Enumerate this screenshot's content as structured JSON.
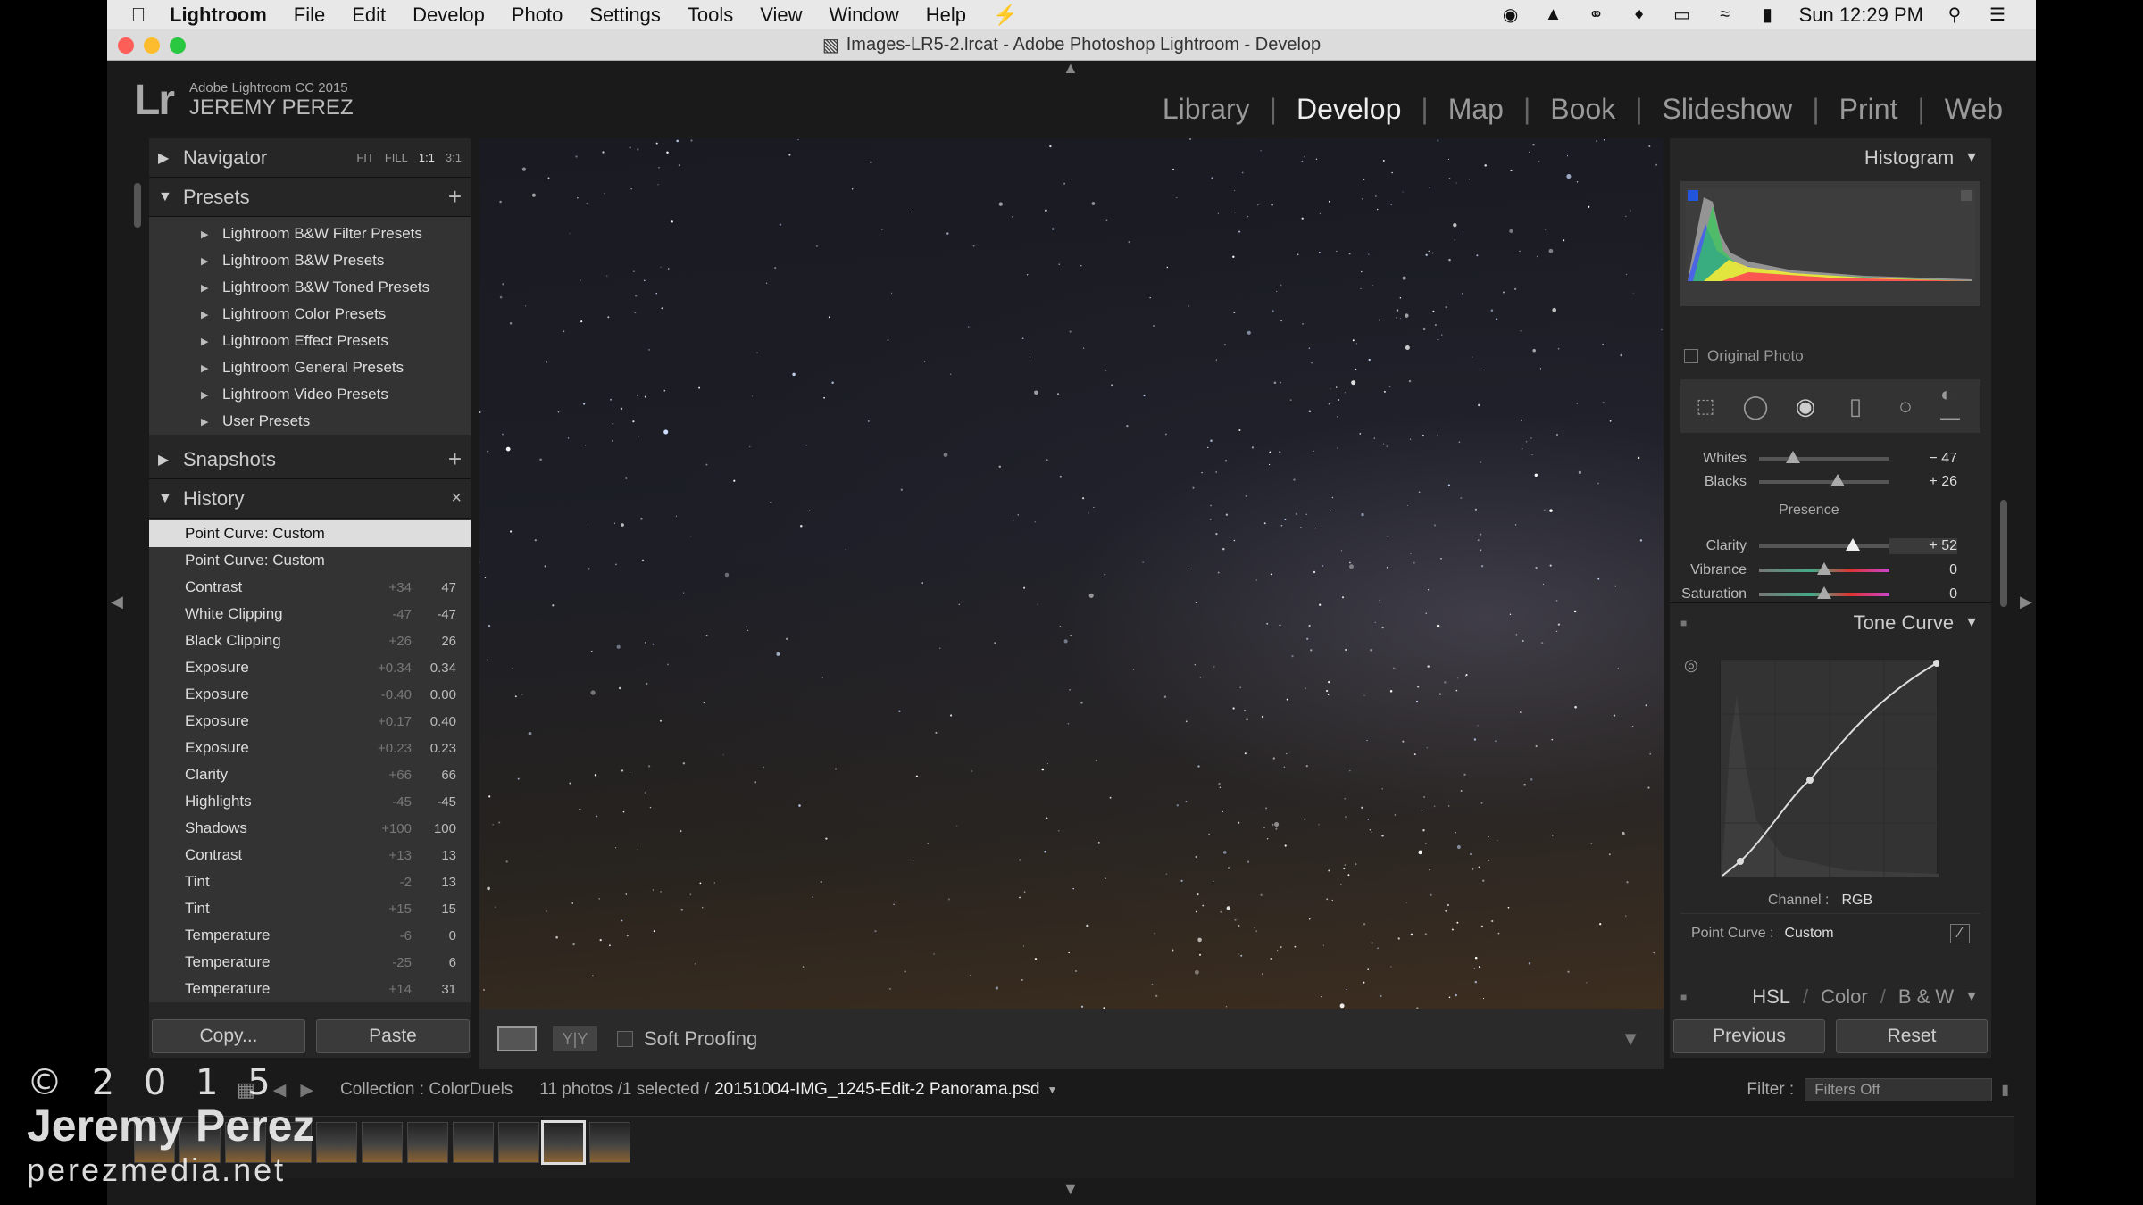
{
  "menubar": {
    "apple_icon": "apple-icon",
    "items": [
      "Lightroom",
      "File",
      "Edit",
      "Develop",
      "Photo",
      "Settings",
      "Tools",
      "View",
      "Window",
      "Help"
    ],
    "clock": "Sun 12:29 PM"
  },
  "window": {
    "title": "Images-LR5-2.lrcat - Adobe Photoshop Lightroom - Develop"
  },
  "identity": {
    "logo": "Lr",
    "product": "Adobe Lightroom CC 2015",
    "user": "JEREMY PEREZ"
  },
  "modules": [
    "Library",
    "Develop",
    "Map",
    "Book",
    "Slideshow",
    "Print",
    "Web"
  ],
  "active_module": "Develop",
  "left": {
    "navigator": {
      "title": "Navigator",
      "zoom": [
        "FIT",
        "FILL",
        "1:1",
        "3:1"
      ]
    },
    "presets": {
      "title": "Presets",
      "items": [
        "Lightroom B&W Filter Presets",
        "Lightroom B&W Presets",
        "Lightroom B&W Toned Presets",
        "Lightroom Color Presets",
        "Lightroom Effect Presets",
        "Lightroom General Presets",
        "Lightroom Video Presets",
        "User Presets"
      ]
    },
    "snapshots": {
      "title": "Snapshots"
    },
    "history": {
      "title": "History",
      "items": [
        {
          "label": "Point Curve: Custom",
          "delta": "",
          "value": ""
        },
        {
          "label": "Point Curve: Custom",
          "delta": "",
          "value": ""
        },
        {
          "label": "Contrast",
          "delta": "+34",
          "value": "47"
        },
        {
          "label": "White Clipping",
          "delta": "-47",
          "value": "-47"
        },
        {
          "label": "Black Clipping",
          "delta": "+26",
          "value": "26"
        },
        {
          "label": "Exposure",
          "delta": "+0.34",
          "value": "0.34"
        },
        {
          "label": "Exposure",
          "delta": "-0.40",
          "value": "0.00"
        },
        {
          "label": "Exposure",
          "delta": "+0.17",
          "value": "0.40"
        },
        {
          "label": "Exposure",
          "delta": "+0.23",
          "value": "0.23"
        },
        {
          "label": "Clarity",
          "delta": "+66",
          "value": "66"
        },
        {
          "label": "Highlights",
          "delta": "-45",
          "value": "-45"
        },
        {
          "label": "Shadows",
          "delta": "+100",
          "value": "100"
        },
        {
          "label": "Contrast",
          "delta": "+13",
          "value": "13"
        },
        {
          "label": "Tint",
          "delta": "-2",
          "value": "13"
        },
        {
          "label": "Tint",
          "delta": "+15",
          "value": "15"
        },
        {
          "label": "Temperature",
          "delta": "-6",
          "value": "0"
        },
        {
          "label": "Temperature",
          "delta": "-25",
          "value": "6"
        },
        {
          "label": "Temperature",
          "delta": "+14",
          "value": "31"
        }
      ]
    },
    "copy_label": "Copy...",
    "paste_label": "Paste"
  },
  "toolbar": {
    "soft_proofing": "Soft Proofing"
  },
  "right": {
    "histogram_title": "Histogram",
    "original_photo": "Original Photo",
    "basic": {
      "whites": {
        "label": "Whites",
        "value": "− 47",
        "pos": 0.26
      },
      "blacks": {
        "label": "Blacks",
        "value": "+ 26",
        "pos": 0.6
      },
      "presence": "Presence",
      "clarity": {
        "label": "Clarity",
        "value": "+ 52",
        "pos": 0.72
      },
      "vibrance": {
        "label": "Vibrance",
        "value": "0",
        "pos": 0.5
      },
      "saturation": {
        "label": "Saturation",
        "value": "0",
        "pos": 0.5
      }
    },
    "tone_curve": {
      "title": "Tone Curve",
      "channel_label": "Channel :",
      "channel_value": "RGB",
      "point_curve_label": "Point Curve :",
      "point_curve_value": "Custom"
    },
    "hsl_tabs": [
      "HSL",
      "Color",
      "B & W"
    ],
    "previous_label": "Previous",
    "reset_label": "Reset"
  },
  "filmstrip": {
    "collection": "Collection : ColorDuels",
    "count": "11 photos /1 selected /",
    "filename": "20151004-IMG_1245-Edit-2 Panorama.psd",
    "filter_label": "Filter :",
    "filter_value": "Filters Off"
  },
  "watermark": {
    "year": "© 2 0 1 5",
    "name": "Jeremy Perez",
    "site": "perezmedia.net"
  }
}
